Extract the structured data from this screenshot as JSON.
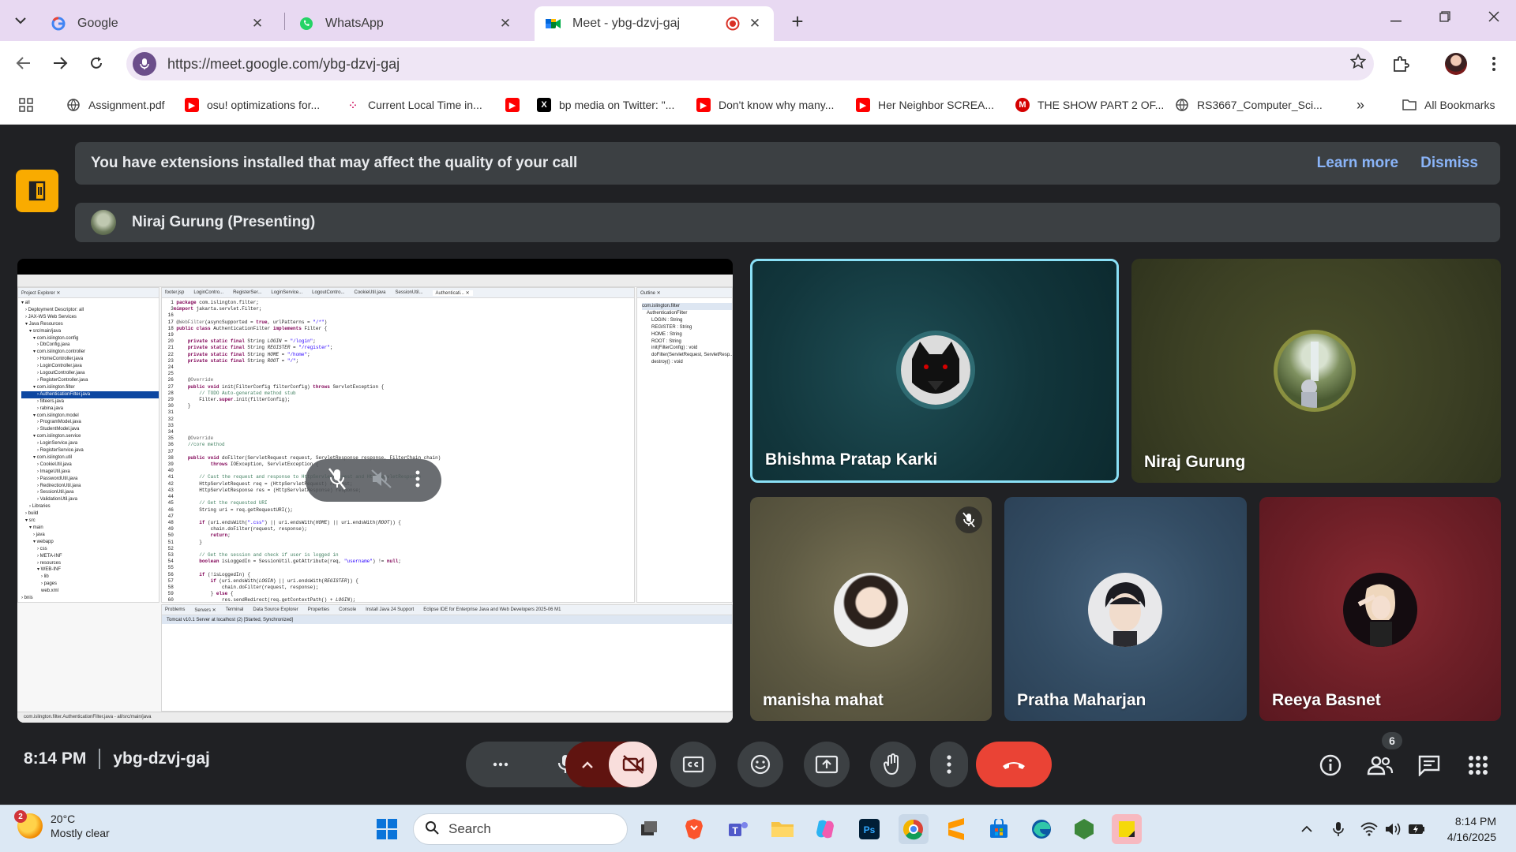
{
  "tabs": [
    {
      "title": "Google",
      "close": "✕"
    },
    {
      "title": "WhatsApp",
      "close": "✕"
    },
    {
      "title": "Meet - ybg-dzvj-gaj",
      "close": "✕"
    }
  ],
  "address_bar": {
    "url": "https://meet.google.com/ybg-dzvj-gaj"
  },
  "bookmarks": {
    "items": [
      {
        "label": "Assignment.pdf"
      },
      {
        "label": "osu! optimizations for..."
      },
      {
        "label": "Current Local Time in..."
      },
      {
        "label": ""
      },
      {
        "label": "bp media on Twitter: \"..."
      },
      {
        "label": "Don't know why many..."
      },
      {
        "label": "Her Neighbor SCREA..."
      },
      {
        "label": "THE SHOW PART 2 OF..."
      },
      {
        "label": "RS3667_Computer_Sci..."
      }
    ],
    "overflow": "»",
    "all_bookmarks": "All Bookmarks"
  },
  "meet": {
    "extension_banner": {
      "message": "You have extensions installed that may affect the quality of your call",
      "learn_more": "Learn more",
      "dismiss": "Dismiss"
    },
    "presenting": "Niraj Gurung (Presenting)",
    "shared_screen": {
      "outline_items": [
        "com.islington.filter",
        "AuthenticationFilter",
        "LOGIN : String",
        "REGISTER : String",
        "HOME : String",
        "ROOT : String",
        "init(FilterConfig) : void",
        "doFilter(ServletRequest, ServletResp...",
        "destroy() : void"
      ],
      "status_bar": "com.islington.filter.AuthenticationFilter.java - all/src/main/java",
      "console_line": "Tomcat v10.1 Server at localhost (2) [Started, Synchronized]"
    },
    "participants": [
      {
        "name": "Bhishma Pratap Karki",
        "speaking": true
      },
      {
        "name": "Niraj Gurung"
      },
      {
        "name": "manisha mahat",
        "muted": true
      },
      {
        "name": "Pratha Maharjan"
      },
      {
        "name": "Reeya Basnet"
      }
    ],
    "controls": {
      "time": "8:14 PM",
      "meeting_code": "ybg-dzvj-gaj",
      "participant_count": "6"
    }
  },
  "taskbar": {
    "weather": {
      "temp": "20°C",
      "condition": "Mostly clear",
      "badge": "2"
    },
    "search_label": "Search",
    "clock": {
      "time": "8:14 PM",
      "date": "4/16/2025"
    }
  },
  "colors": {
    "meet_bg": "#202124",
    "banner_bg": "#3c4043",
    "link": "#8ab4f8",
    "end_call": "#ea4335",
    "speaking_border": "#8ae0f6",
    "camera_off": "#f9dedc"
  }
}
